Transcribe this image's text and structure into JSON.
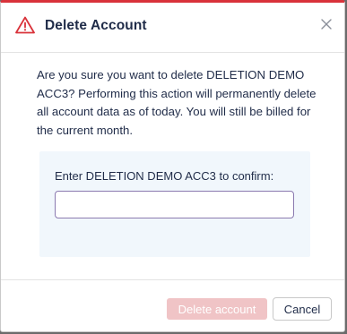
{
  "dialog": {
    "title": "Delete Account",
    "message": "Are you sure you want to delete DELETION DEMO ACC3? Performing this action will permanently delete all account data as of today. You will still be billed for the current month.",
    "confirm_label": "Enter DELETION DEMO ACC3 to confirm:",
    "confirm_value": "",
    "confirm_placeholder": "",
    "delete_label": "Delete account",
    "cancel_label": "Cancel"
  },
  "icons": {
    "warning": "warning-triangle-icon",
    "close": "close-icon"
  },
  "colors": {
    "accent": "#d9323a",
    "title_text": "#1f2b48",
    "confirm_bg": "#f1f7fc",
    "delete_disabled_bg": "#f0c4c6",
    "input_border": "#8b7ab0"
  }
}
